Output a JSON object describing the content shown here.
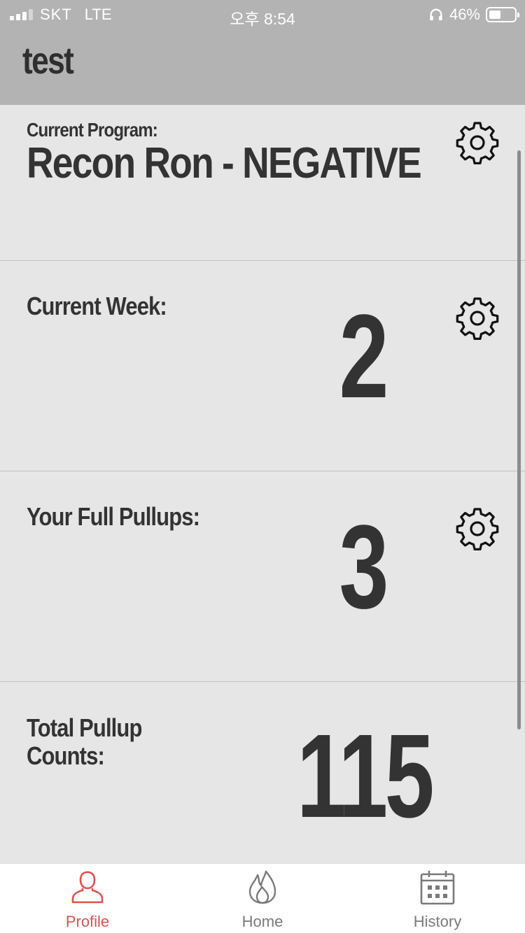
{
  "status_bar": {
    "carrier": "SKT",
    "network": "LTE",
    "time": "오후 8:54",
    "battery": "46%"
  },
  "header": {
    "title": "test"
  },
  "program": {
    "label": "Current Program:",
    "name": "Recon Ron - NEGATIVE"
  },
  "week": {
    "label": "Current Week:",
    "value": "2"
  },
  "pullups": {
    "label": "Your Full Pullups:",
    "value": "3"
  },
  "total": {
    "label": "Total Pullup Counts:",
    "value": "115"
  },
  "tabbar": {
    "tabs": [
      {
        "label": "Profile",
        "icon": "person-icon",
        "active": true
      },
      {
        "label": "Home",
        "icon": "flame-icon",
        "active": false
      },
      {
        "label": "History",
        "icon": "calendar-icon",
        "active": false
      }
    ]
  },
  "colors": {
    "header_bg": "#b3b3b3",
    "content_bg": "#e6e6e6",
    "text": "#333333",
    "accent_active": "#d9534f",
    "tab_inactive": "#7a7a7a"
  }
}
